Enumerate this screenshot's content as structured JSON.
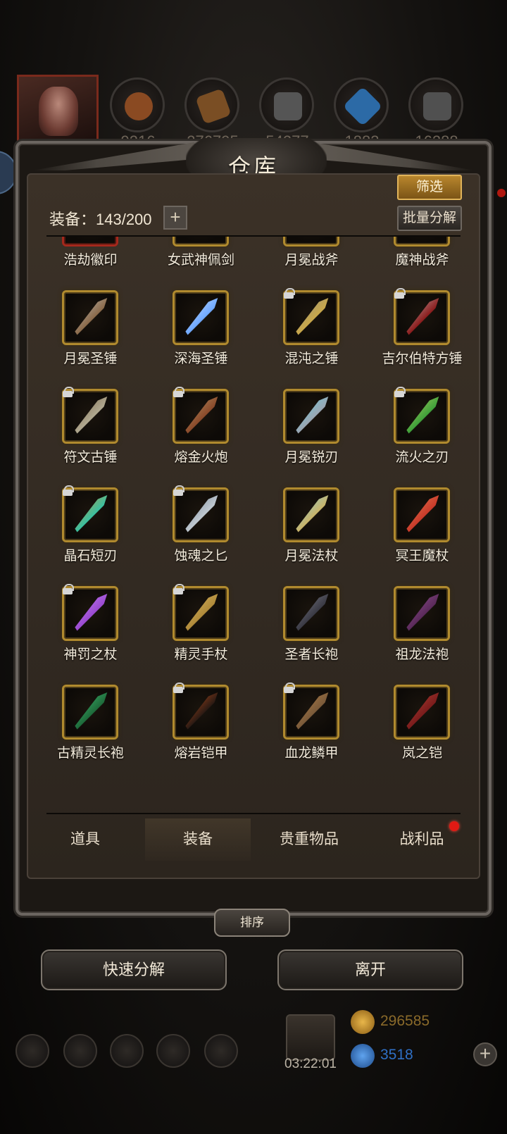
{
  "top_bar": {
    "resources": [
      {
        "value": "9216",
        "icon": "gourd-icon",
        "color": "#8a4a22"
      },
      {
        "value": "276795",
        "icon": "wood-icon",
        "color": "#7a4e24"
      },
      {
        "value": "54277",
        "icon": "stone-icon",
        "color": "#555555"
      },
      {
        "value": "1883",
        "icon": "crystal-icon",
        "color": "#2c6aa6"
      },
      {
        "value": "16288",
        "icon": "iron-icon",
        "color": "#505050"
      }
    ]
  },
  "dialog": {
    "title": "仓库",
    "filter_label": "筛选",
    "bulk_label": "批量分解",
    "capacity_label": "装备：143/200",
    "capacity_plus": "+"
  },
  "items": [
    {
      "name": "浩劫徽印",
      "frame": "red",
      "locked": false,
      "art": "seal"
    },
    {
      "name": "女武神佩剑",
      "frame": "gold",
      "locked": false,
      "art": "sword"
    },
    {
      "name": "月冕战斧",
      "frame": "gold",
      "locked": false,
      "art": "axe"
    },
    {
      "name": "魔神战斧",
      "frame": "gold",
      "locked": false,
      "art": "axe-red"
    },
    {
      "name": "月冕圣锤",
      "frame": "gold",
      "locked": false,
      "art": "hammer"
    },
    {
      "name": "深海圣锤",
      "frame": "gold",
      "locked": false,
      "art": "hammer-blue"
    },
    {
      "name": "混沌之锤",
      "frame": "gold",
      "locked": true,
      "art": "hammer-gold"
    },
    {
      "name": "吉尔伯特方锤",
      "frame": "gold",
      "locked": true,
      "art": "hammer-red"
    },
    {
      "name": "符文古锤",
      "frame": "gold",
      "locked": true,
      "art": "hammer-gray"
    },
    {
      "name": "熔金火炮",
      "frame": "gold",
      "locked": true,
      "art": "cannon"
    },
    {
      "name": "月冕锐刃",
      "frame": "gold",
      "locked": false,
      "art": "blade"
    },
    {
      "name": "流火之刃",
      "frame": "gold",
      "locked": true,
      "art": "scimitar"
    },
    {
      "name": "晶石短刃",
      "frame": "gold",
      "locked": true,
      "art": "dagger"
    },
    {
      "name": "蚀魂之匕",
      "frame": "gold",
      "locked": true,
      "art": "dagger-silver"
    },
    {
      "name": "月冕法杖",
      "frame": "gold",
      "locked": false,
      "art": "staff"
    },
    {
      "name": "冥王魔杖",
      "frame": "gold",
      "locked": false,
      "art": "staff-red"
    },
    {
      "name": "神罚之杖",
      "frame": "gold",
      "locked": true,
      "art": "staff-purple"
    },
    {
      "name": "精灵手杖",
      "frame": "gold",
      "locked": true,
      "art": "staff-wood"
    },
    {
      "name": "圣者长袍",
      "frame": "gold",
      "locked": false,
      "art": "robe-dark"
    },
    {
      "name": "祖龙法袍",
      "frame": "gold",
      "locked": false,
      "art": "robe-purple"
    },
    {
      "name": "古精灵长袍",
      "frame": "gold",
      "locked": false,
      "art": "cloak-green"
    },
    {
      "name": "熔岩铠甲",
      "frame": "gold",
      "locked": true,
      "art": "armor-lava"
    },
    {
      "name": "血龙鳞甲",
      "frame": "gold",
      "locked": true,
      "art": "armor-bronze"
    },
    {
      "name": "岚之铠",
      "frame": "gold",
      "locked": false,
      "art": "armor-red"
    }
  ],
  "tabs": [
    {
      "label": "道具",
      "active": false
    },
    {
      "label": "装备",
      "active": true
    },
    {
      "label": "贵重物品",
      "active": false
    },
    {
      "label": "战利品",
      "active": false,
      "notification": true
    }
  ],
  "sort_label": "排序",
  "buttons": {
    "quick_decompose": "快速分解",
    "leave": "离开"
  },
  "hud": {
    "timer": "03:22:01",
    "gold": "296585",
    "gems": "3518",
    "colors": {
      "gold": "#c08a2a",
      "gems": "#2f6fc4"
    }
  }
}
